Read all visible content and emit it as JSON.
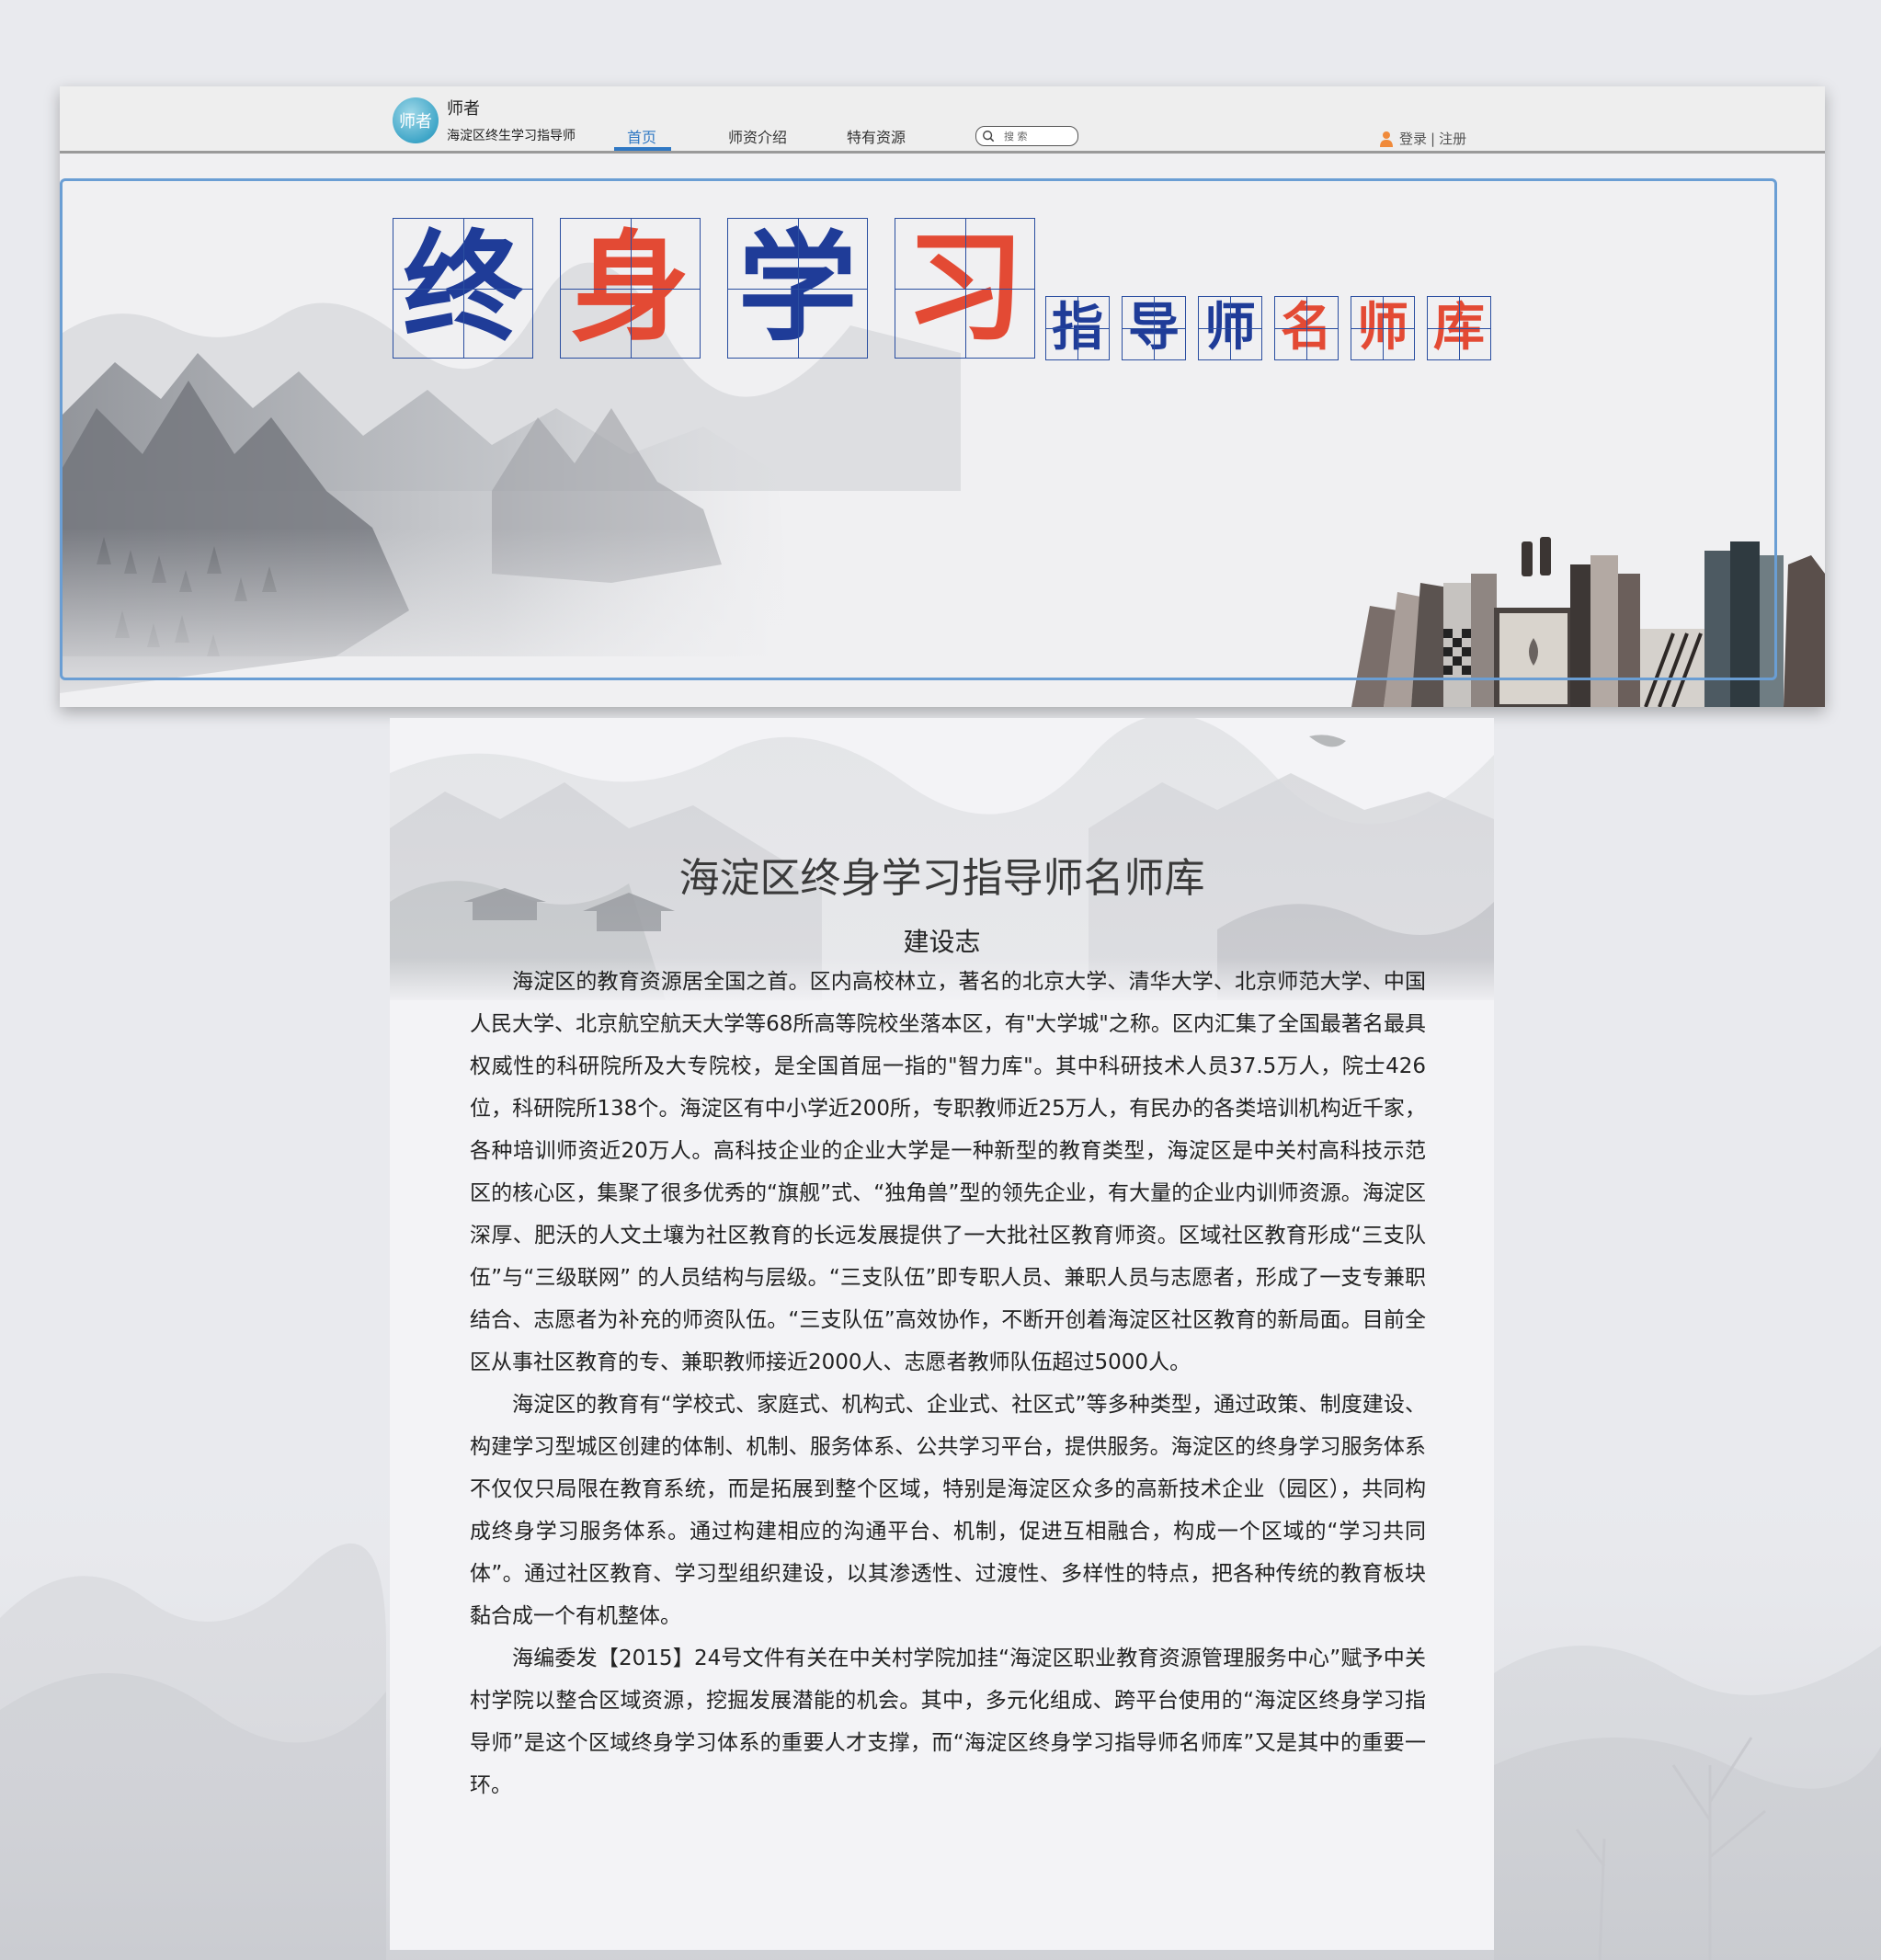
{
  "header": {
    "logo_text": "师者",
    "brand_name": "师者",
    "brand_sub": "海淀区终生学习指导师"
  },
  "nav": {
    "items": [
      {
        "label": "首页",
        "active": true
      },
      {
        "label": "师资介绍",
        "active": false
      },
      {
        "label": "特有资源",
        "active": false
      }
    ],
    "search_placeholder": "搜 索",
    "login_label": "登录",
    "separator": "|",
    "register_label": "注册"
  },
  "banner": {
    "big_chars": [
      {
        "char": "终",
        "color": "blue"
      },
      {
        "char": "身",
        "color": "red"
      },
      {
        "char": "学",
        "color": "blue"
      },
      {
        "char": "习",
        "color": "red"
      }
    ],
    "small_chars": [
      {
        "char": "指",
        "color": "blue"
      },
      {
        "char": "导",
        "color": "blue"
      },
      {
        "char": "师",
        "color": "blue"
      },
      {
        "char": "名",
        "color": "red"
      },
      {
        "char": "师",
        "color": "red"
      },
      {
        "char": "库",
        "color": "red"
      }
    ]
  },
  "colors": {
    "accent_blue": "#2f78c4",
    "char_blue": "#1f3c98",
    "char_red": "#e34a34",
    "frame_blue": "#6a9ed4"
  },
  "article": {
    "title": "海淀区终身学习指导师名师库",
    "subtitle": "建设志",
    "paragraphs": [
      "海淀区的教育资源居全国之首。区内高校林立，著名的北京大学、清华大学、北京师范大学、中国人民大学、北京航空航天大学等68所高等院校坐落本区，有\"大学城\"之称。区内汇集了全国最著名最具权威性的科研院所及大专院校，是全国首屈一指的\"智力库\"。其中科研技术人员37.5万人，院士426位，科研院所138个。海淀区有中小学近200所，专职教师近25万人，有民办的各类培训机构近千家，各种培训师资近20万人。高科技企业的企业大学是一种新型的教育类型，海淀区是中关村高科技示范区的核心区，集聚了很多优秀的“旗舰”式、“独角兽”型的领先企业，有大量的企业内训师资源。海淀区深厚、肥沃的人文土壤为社区教育的长远发展提供了一大批社区教育师资。区域社区教育形成“三支队伍”与“三级联网” 的人员结构与层级。“三支队伍”即专职人员、兼职人员与志愿者，形成了一支专兼职结合、志愿者为补充的师资队伍。“三支队伍”高效协作，不断开创着海淀区社区教育的新局面。目前全区从事社区教育的专、兼职教师接近2000人、志愿者教师队伍超过5000人。",
      "海淀区的教育有“学校式、家庭式、机构式、企业式、社区式”等多种类型，通过政策、制度建设、构建学习型城区创建的体制、机制、服务体系、公共学习平台，提供服务。海淀区的终身学习服务体系不仅仅只局限在教育系统，而是拓展到整个区域，特别是海淀区众多的高新技术企业（园区），共同构成终身学习服务体系。通过构建相应的沟通平台、机制，促进互相融合，构成一个区域的“学习共同体”。通过社区教育、学习型组织建设，以其渗透性、过渡性、多样性的特点，把各种传统的教育板块黏合成一个有机整体。",
      "海编委发【2015】24号文件有关在中关村学院加挂“海淀区职业教育资源管理服务中心”赋予中关村学院以整合区域资源，挖掘发展潜能的机会。其中，多元化组成、跨平台使用的“海淀区终身学习指导师”是这个区域终身学习体系的重要人才支撑，而“海淀区终身学习指导师名师库”又是其中的重要一环。"
    ]
  }
}
